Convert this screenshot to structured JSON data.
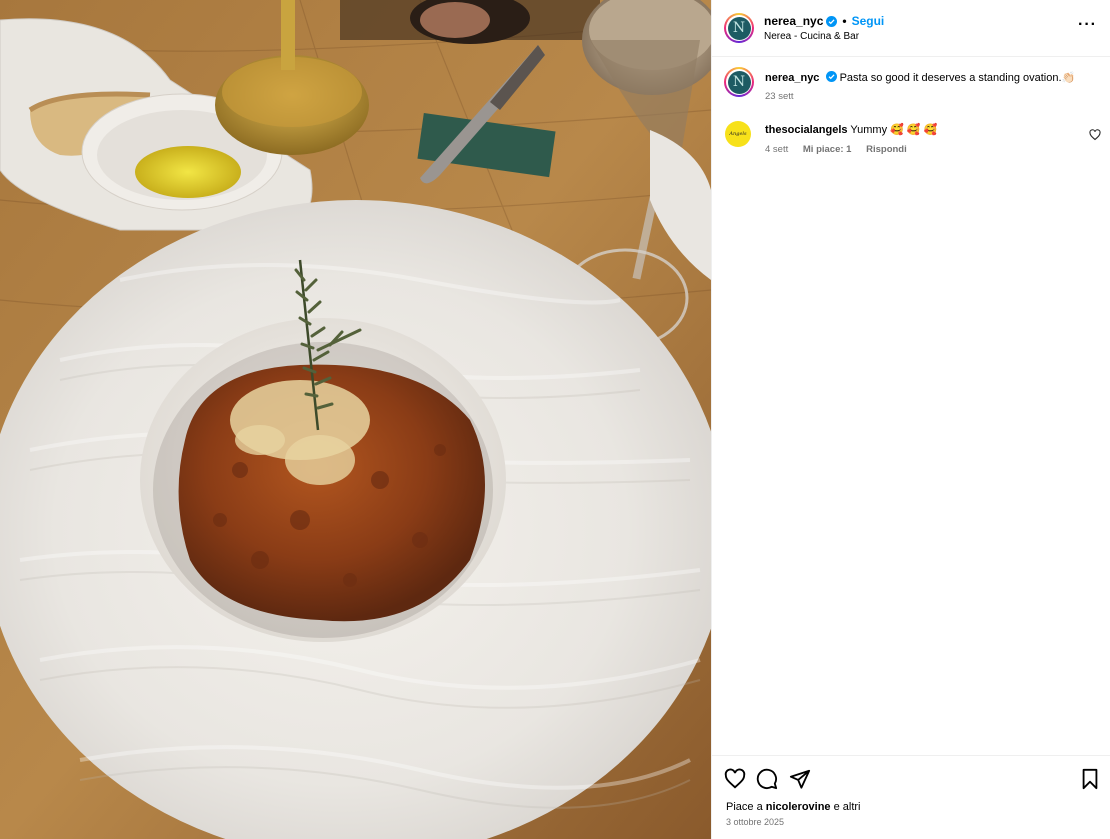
{
  "post": {
    "username": "nerea_nyc",
    "follow_label": "Segui",
    "location": "Nerea - Cucina & Bar",
    "avatar_letter": "N"
  },
  "caption": {
    "username": "nerea_nyc",
    "text": "Pasta so good it deserves a standing ovation.",
    "emoji": "👏🏻",
    "time": "23 sett"
  },
  "comments": [
    {
      "username": "thesocialangels",
      "text": "Yummy 🥰 🥰 🥰",
      "time": "4 sett",
      "likes": "Mi piace: 1",
      "reply": "Rispondi",
      "avatar_text": "Angels"
    }
  ],
  "footer": {
    "liked_prefix": "Piace a ",
    "liked_user": "nicolerovine",
    "liked_suffix": " e altri",
    "date": "3 ottobre 2025"
  },
  "icons": {
    "verified": "verified-badge-icon",
    "more": "more-options-icon",
    "like": "heart-icon",
    "comment": "comment-icon",
    "share": "send-icon",
    "save": "bookmark-icon"
  },
  "colors": {
    "accent": "#0095f6",
    "verified": "#0095f6",
    "muted": "#737373"
  }
}
